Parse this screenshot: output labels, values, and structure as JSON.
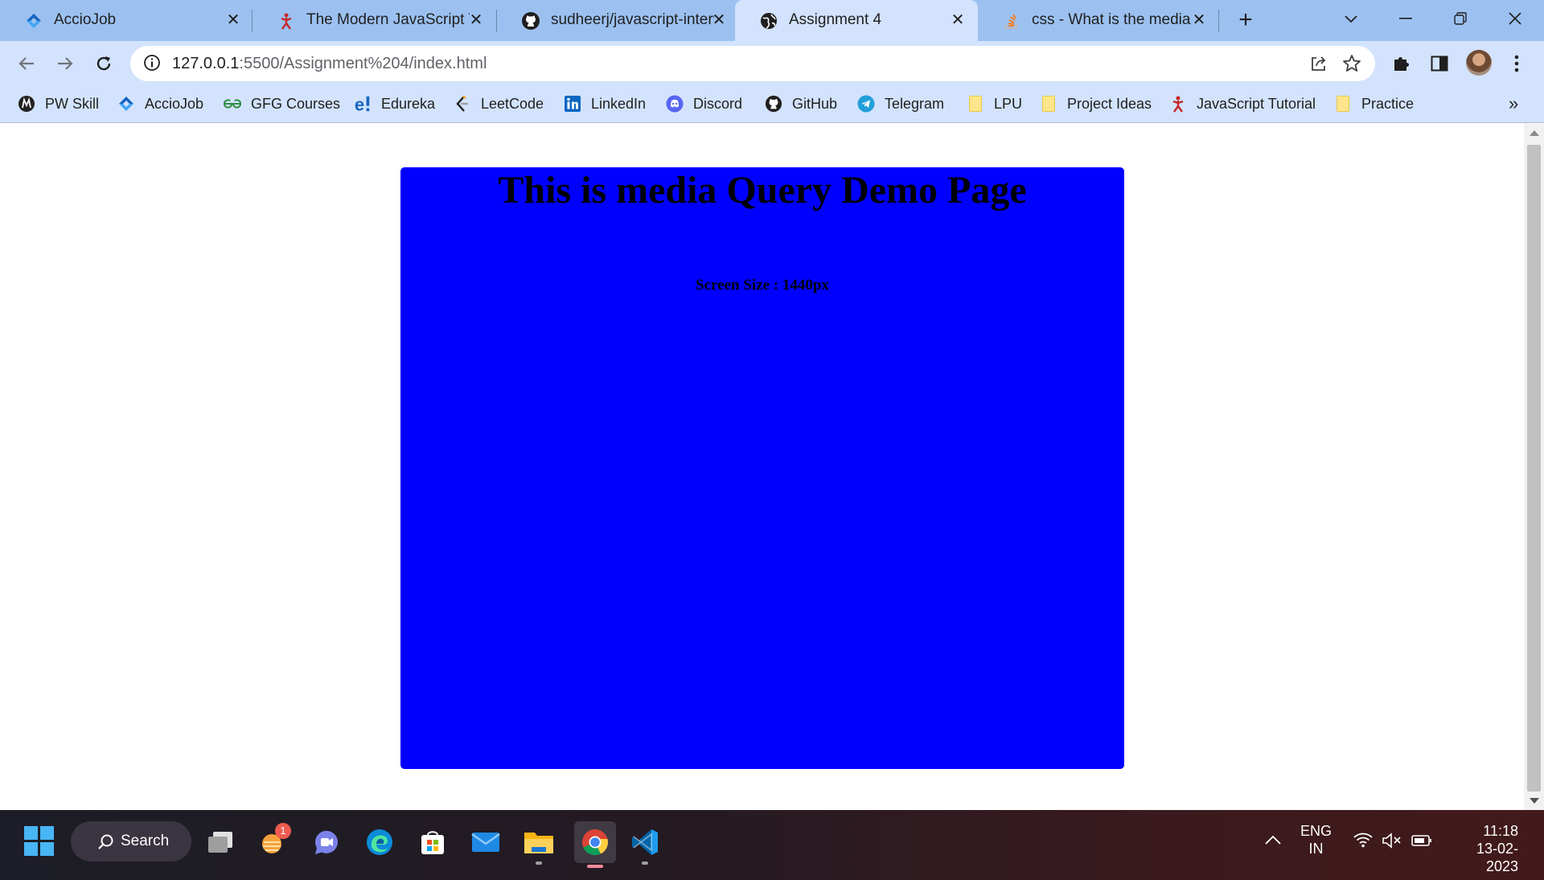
{
  "tabs": [
    {
      "title": "AccioJob",
      "icon": "acciojob-icon"
    },
    {
      "title": "The Modern JavaScript Tu",
      "icon": "javascript-tutorial-icon"
    },
    {
      "title": "sudheerj/javascript-interv",
      "icon": "github-icon"
    },
    {
      "title": "Assignment 4",
      "icon": "globe-icon",
      "active": true
    },
    {
      "title": "css - What is the media q",
      "icon": "stackoverflow-icon"
    }
  ],
  "address_bar": {
    "url_host": "127.0.0.1",
    "url_rest": ":5500/Assignment%204/index.html"
  },
  "bookmarks": [
    {
      "label": "PW Skill",
      "icon": "pwskills-icon"
    },
    {
      "label": "AccioJob",
      "icon": "acciojob-icon"
    },
    {
      "label": "GFG Courses",
      "icon": "gfg-icon"
    },
    {
      "label": "Edureka",
      "icon": "edureka-icon"
    },
    {
      "label": "LeetCode",
      "icon": "leetcode-icon"
    },
    {
      "label": "LinkedIn",
      "icon": "linkedin-icon"
    },
    {
      "label": "Discord",
      "icon": "discord-icon"
    },
    {
      "label": "GitHub",
      "icon": "github-icon"
    },
    {
      "label": "Telegram",
      "icon": "telegram-icon"
    },
    {
      "label": "LPU",
      "icon": "folder-icon"
    },
    {
      "label": "Project Ideas",
      "icon": "folder-icon"
    },
    {
      "label": "JavaScript Tutorial",
      "icon": "javascript-tutorial-icon"
    },
    {
      "label": "Practice",
      "icon": "folder-icon"
    }
  ],
  "page": {
    "heading": "This is media Query Demo Page",
    "screen_size_text": "Screen Size : 1440px",
    "box_color": "#0000ff"
  },
  "taskbar": {
    "search_label": "Search",
    "badge_count": "1",
    "language_line1": "ENG",
    "language_line2": "IN",
    "time": "11:18",
    "date": "13-02-2023"
  },
  "colors": {
    "tabstrip": "#9cc1f0",
    "toolbar": "#d3e3fd",
    "accent_blue": "#0000ff"
  }
}
